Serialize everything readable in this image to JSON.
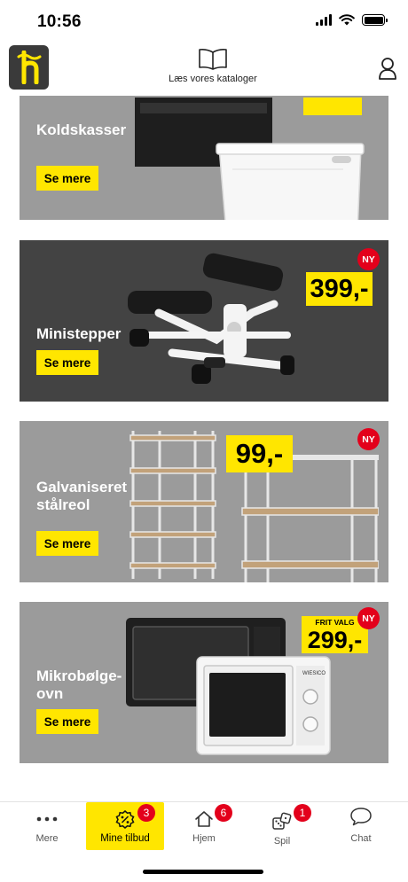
{
  "status": {
    "time": "10:56"
  },
  "header": {
    "catalog_label": "Læs vores kataloger",
    "logo_icon": "h-logo-icon",
    "catalog_icon": "book-icon",
    "profile_icon": "person-icon"
  },
  "cards": [
    {
      "title": "Koldskasser",
      "button": "Se mere",
      "price": "",
      "badge": ""
    },
    {
      "title": "Ministepper",
      "button": "Se mere",
      "price": "399,-",
      "badge": "NY"
    },
    {
      "title_line1": "Galvaniseret",
      "title_line2": "stålreol",
      "button": "Se mere",
      "price": "99,-",
      "badge": "NY"
    },
    {
      "title_line1": "Mikrobølge-",
      "title_line2": "ovn",
      "button": "Se mere",
      "price_label": "FRIT VALG",
      "price": "299,-",
      "badge": "NY",
      "brand_text": "WIESICO"
    }
  ],
  "tabs": [
    {
      "label": "Mere",
      "icon": "dots-icon",
      "badge": ""
    },
    {
      "label": "Mine tilbud",
      "icon": "discount-icon",
      "badge": "3"
    },
    {
      "label": "Hjem",
      "icon": "home-icon",
      "badge": "6"
    },
    {
      "label": "Spil",
      "icon": "dice-icon",
      "badge": "1"
    },
    {
      "label": "Chat",
      "icon": "chat-icon",
      "badge": ""
    }
  ],
  "colors": {
    "accent": "#ffe600",
    "badge": "#e3001b",
    "card_gray": "#9b9b9b",
    "card_dark": "#434343"
  }
}
